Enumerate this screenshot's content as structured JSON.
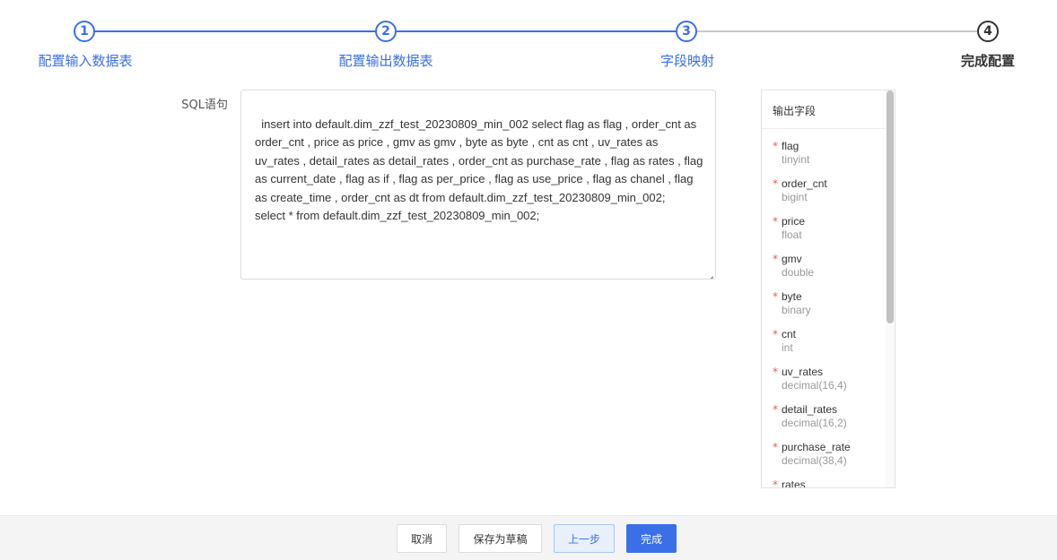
{
  "stepper": {
    "steps": [
      {
        "number": "1",
        "label": "配置输入数据表"
      },
      {
        "number": "2",
        "label": "配置输出数据表"
      },
      {
        "number": "3",
        "label": "字段映射"
      },
      {
        "number": "4",
        "label": "完成配置"
      }
    ]
  },
  "form": {
    "sql_label": "SQL语句",
    "sql_value": "insert into default.dim_zzf_test_20230809_min_002 select flag as flag , order_cnt as order_cnt , price as price , gmv as gmv , byte as byte , cnt as cnt , uv_rates as uv_rates , detail_rates as detail_rates , order_cnt as purchase_rate , flag as rates , flag as current_date , flag as if , flag as per_price , flag as use_price , flag as chanel , flag as create_time , order_cnt as dt from default.dim_zzf_test_20230809_min_002;\nselect * from default.dim_zzf_test_20230809_min_002;"
  },
  "output_fields": {
    "title": "输出字段",
    "required_mark": "*",
    "fields": [
      {
        "name": "flag",
        "type": "tinyint"
      },
      {
        "name": "order_cnt",
        "type": "bigint"
      },
      {
        "name": "price",
        "type": "float"
      },
      {
        "name": "gmv",
        "type": "double"
      },
      {
        "name": "byte",
        "type": "binary"
      },
      {
        "name": "cnt",
        "type": "int"
      },
      {
        "name": "uv_rates",
        "type": "decimal(16,4)"
      },
      {
        "name": "detail_rates",
        "type": "decimal(16,2)"
      },
      {
        "name": "purchase_rate",
        "type": "decimal(38,4)"
      },
      {
        "name": "rates",
        "type": ""
      }
    ]
  },
  "footer": {
    "cancel": "取消",
    "save_draft": "保存为草稿",
    "prev": "上一步",
    "finish": "完成"
  },
  "colors": {
    "accent": "#3a6fe8",
    "required": "#e85a5a"
  }
}
